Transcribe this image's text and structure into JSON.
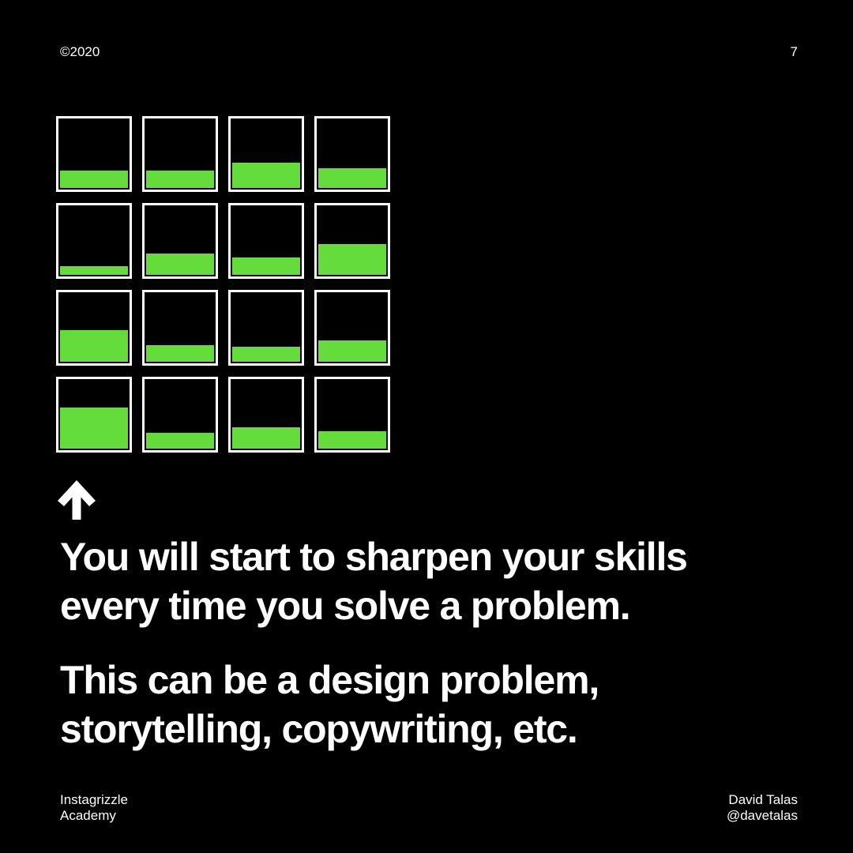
{
  "header": {
    "copyright": "©2020",
    "page_number": "7"
  },
  "colors": {
    "background": "#000000",
    "text": "#ffffff",
    "accent_green": "#64dc3c",
    "cell_border": "#ffffff"
  },
  "progress_grid": {
    "columns": 4,
    "rows": 4,
    "fill_levels_percent": [
      25,
      25,
      36,
      28,
      12,
      30,
      24,
      43,
      45,
      23,
      21,
      30,
      58,
      22,
      30,
      24
    ]
  },
  "arrow_icon": "arrow-up-icon",
  "body": {
    "headline_lines": [
      "You will start to sharpen your skills",
      "every time you solve a problem."
    ],
    "subline_lines": [
      "This can be a design problem,",
      "storytelling, copywriting, etc."
    ]
  },
  "footer": {
    "left_lines": [
      "Instagrizzle",
      "Academy"
    ],
    "right_lines": [
      "David Talas",
      "@davetalas"
    ]
  }
}
